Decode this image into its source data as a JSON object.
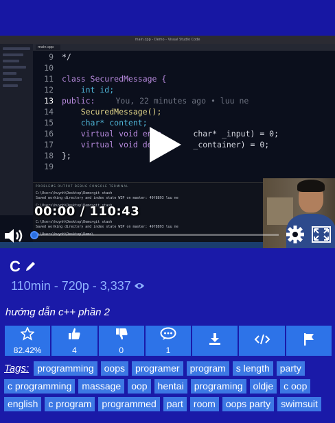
{
  "video": {
    "window_title": "main.cpp - Demo - Visual Studio Code",
    "file_tab": "main.cpp",
    "code_lines": [
      {
        "num": "9",
        "text": "*/"
      },
      {
        "num": "10",
        "text": ""
      },
      {
        "num": "11",
        "text": "class SecuredMessage {"
      },
      {
        "num": "12",
        "text": "    int id;"
      },
      {
        "num": "13",
        "text": "public:"
      },
      {
        "num": "14",
        "text": "    SecuredMessage();"
      },
      {
        "num": "15",
        "text": "    char* content;"
      },
      {
        "num": "16",
        "text": "    virtual void enco"
      },
      {
        "num": "17",
        "text": "    virtual void deco"
      },
      {
        "num": "18",
        "text": "};"
      },
      {
        "num": "19",
        "text": ""
      }
    ],
    "line16_tail": "char* _input) = 0;",
    "line17_tail": "_container) = 0;",
    "blame_text": "You, 22 minutes ago • luu ne",
    "terminal_tabs": "PROBLEMS   OUTPUT   DEBUG CONSOLE   TERMINAL",
    "terminal_lines": [
      "C:\\Users\\huynh\\Desktop\\Demo>git stash",
      "Saved working directory and index state WIP on master: 49f8893 luu ne",
      "C:\\Users\\huynh\\Desktop\\Demo>git stash",
      "C:\\Users\\huynh\\Desktop\\Demo>git stash",
      "Saved working directory and index state WIP on master: 49f8893 luu ne",
      "C:\\Users\\huynh\\Desktop\\Demo\\"
    ],
    "time_display": "00:00 / 110:43",
    "progress_fraction": 0.0
  },
  "info": {
    "title": "C",
    "meta": "110min - 720p - 3,337",
    "description": "hướng dẫn c++ phần 2"
  },
  "actions": [
    {
      "name": "rating",
      "icon": "star-icon",
      "count": "82.42%"
    },
    {
      "name": "like",
      "icon": "thumbs-up-icon",
      "count": "4"
    },
    {
      "name": "dislike",
      "icon": "thumbs-down-icon",
      "count": "0"
    },
    {
      "name": "comments",
      "icon": "comment-icon",
      "count": "1"
    },
    {
      "name": "download",
      "icon": "download-icon",
      "count": ""
    },
    {
      "name": "embed",
      "icon": "code-icon",
      "count": ""
    },
    {
      "name": "report",
      "icon": "flag-icon",
      "count": ""
    }
  ],
  "tags_label": "Tags:",
  "tags": [
    "programming",
    "oops",
    "programer",
    "program",
    "s length",
    "party",
    "c programming",
    "massage",
    "oop",
    "hentai",
    "programing",
    "oldje",
    "c oop",
    "english",
    "c program",
    "programmed",
    "part",
    "room",
    "oops party",
    "swimsuit"
  ],
  "colors": {
    "background": "#1a1aa8",
    "action_button": "#2d73e8",
    "tag": "#3c78e4",
    "meta_text": "#8fb2ff"
  }
}
